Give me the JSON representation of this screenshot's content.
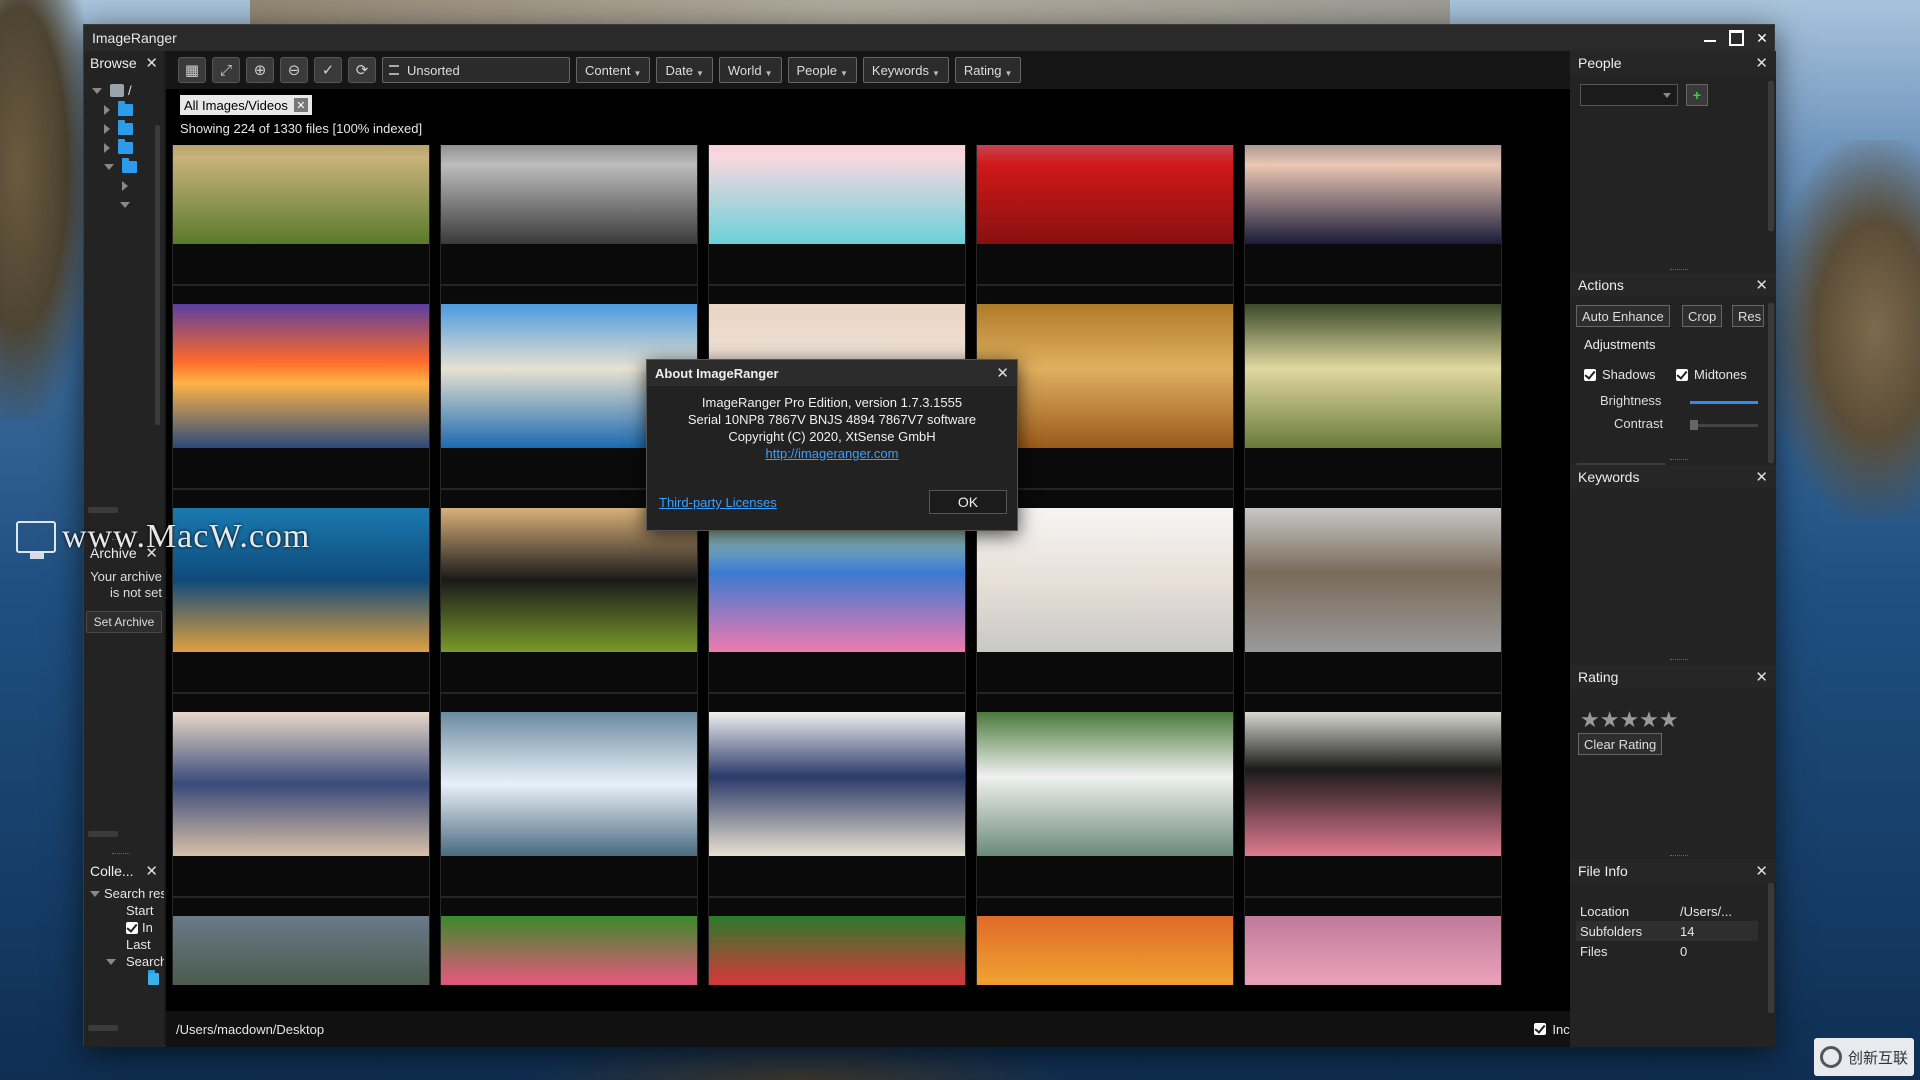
{
  "app": {
    "title": "ImageRanger",
    "close_glyph": "✕"
  },
  "watermarks": {
    "left_text": "www.MacW.com",
    "right_text": "创新互联"
  },
  "browse_panel": {
    "title": "Browse",
    "root_label": "/"
  },
  "archive_panel": {
    "title": "Archive",
    "message": "Your archive is not set",
    "set_button": "Set Archive"
  },
  "collections_panel": {
    "title": "Colle...",
    "items": [
      {
        "label": "Search results",
        "indent": 0,
        "expander": "down"
      },
      {
        "label": "Start",
        "indent": 1
      },
      {
        "label": "In",
        "indent": 1,
        "checked": true
      },
      {
        "label": "Last",
        "indent": 1
      },
      {
        "label": "Search",
        "indent": 1,
        "expander": "down"
      }
    ]
  },
  "toolbar": {
    "icons": [
      "grid-view-icon",
      "fit-icon",
      "zoom-in-icon",
      "zoom-out-icon",
      "check-icon",
      "refresh-icon"
    ],
    "icon_glyphs": [
      "▦",
      "⤢",
      "⊕",
      "⊖",
      "✓",
      "⟳"
    ],
    "sort_label": "Unsorted",
    "filters": [
      "Content",
      "Date",
      "World",
      "People",
      "Keywords",
      "Rating"
    ]
  },
  "filter_tag": {
    "label": "All Images/Videos",
    "remove_glyph": "✕"
  },
  "status": "Showing 224 of 1330 files [100% indexed]",
  "thumbnails": [
    {
      "name": "girl-flowers",
      "grad": "linear-gradient(180deg,#7a6a3a,#c9b27b 40%,#5a7a2a)"
    },
    {
      "name": "white-dress-dark",
      "grad": "linear-gradient(180deg,#2a2a2a,#bdbdbd 45%,#3a3a3a)"
    },
    {
      "name": "cupcake",
      "grad": "linear-gradient(180deg,#f4a9c4,#f7d8df 40%,#6bd0d9)"
    },
    {
      "name": "red-dress",
      "grad": "linear-gradient(180deg,#b8a6c8,#d01818 45%,#8a1010)"
    },
    {
      "name": "woman-lying",
      "grad": "linear-gradient(180deg,#2b2b4a,#e9c7b3 45%,#1b1b3a)"
    },
    {
      "name": "sunset-silhouette",
      "grad": "linear-gradient(180deg,#5a3fa0,#ff6a2a 40%,#ffb347 55%,#2a4a7a)"
    },
    {
      "name": "coastal-town",
      "grad": "linear-gradient(180deg,#4a9be0,#e8e1d0 45%,#1b6ab0)"
    },
    {
      "name": "woman-bag",
      "grad": "linear-gradient(180deg,#e9d3c5,#f1e4da 45%,#c9a090)"
    },
    {
      "name": "woman-lingerie",
      "grad": "linear-gradient(180deg,#b07c2a,#e0b060 45%,#9a5a1a)"
    },
    {
      "name": "violinist",
      "grad": "linear-gradient(180deg,#3a4a2a,#e0d8a0 45%,#6a7a3a)"
    },
    {
      "name": "tropical-fish",
      "grad": "linear-gradient(180deg,#1a7ab0,#0f4a7a 50%,#e0a040)"
    },
    {
      "name": "woman-black-top",
      "grad": "linear-gradient(180deg,#d9b07a,#1a1a1a 50%,#7a9a2a)"
    },
    {
      "name": "bluebird-blossom",
      "grad": "linear-gradient(180deg,#c9e8a0,#3a7ad0 45%,#f07ab0)"
    },
    {
      "name": "brides-group",
      "grad": "linear-gradient(180deg,#f5f5f5,#e8e0d8 50%,#c8c8c8)"
    },
    {
      "name": "kitten",
      "grad": "linear-gradient(180deg,#c8c8c8,#7a6a5a 45%,#9a9a9a)"
    },
    {
      "name": "sleeping-child",
      "grad": "linear-gradient(180deg,#e8d8c8,#3a4a7a 50%,#d8c0a8)"
    },
    {
      "name": "bride-running",
      "grad": "linear-gradient(180deg,#6a8aa0,#e8f0f8 50%,#4a6a80)"
    },
    {
      "name": "woman-sweater",
      "grad": "linear-gradient(180deg,#f0f0f0,#2a3a6a 45%,#e8e0d0)"
    },
    {
      "name": "crane-bird",
      "grad": "linear-gradient(180deg,#4a7a3a,#f0f0f0 45%,#6a8a7a)"
    },
    {
      "name": "woman-bench",
      "grad": "linear-gradient(180deg,#d8d8d0,#1a1a1a 40%,#e07a90)"
    },
    {
      "name": "girl-umbrella",
      "grad": "linear-gradient(180deg,#6a7a8a,#4a5a4a 50%,#c08a70)"
    },
    {
      "name": "parrots",
      "grad": "linear-gradient(180deg,#3a8a2a,#e05a7a 45%,#2a5a1a)"
    },
    {
      "name": "train-tracks",
      "grad": "linear-gradient(180deg,#2a7a2a,#d03a3a 45%,#4a4a3a)"
    },
    {
      "name": "autumn-leaves",
      "grad": "linear-gradient(180deg,#e06a2a,#f0a030 45%,#c02a2a)"
    },
    {
      "name": "woman-lavender",
      "grad": "linear-gradient(180deg,#c07a9a,#e8a0b8 45%,#8a6a9a)"
    }
  ],
  "path_bar": {
    "path": "/Users/macdown/Desktop",
    "include_label": "Include Subfold"
  },
  "about_dialog": {
    "title": "About ImageRanger",
    "line1": "ImageRanger Pro Edition, version 1.7.3.1555",
    "line2": "Serial 10NP8 7867V BNJS 4894 7867V7 software",
    "line3": "Copyright (C) 2020, XtSense GmbH",
    "url": "http://imageranger.com",
    "licenses_link": "Third-party Licenses",
    "ok": "OK"
  },
  "people_panel": {
    "title": "People",
    "add_glyph": "+"
  },
  "actions_panel": {
    "title": "Actions",
    "buttons": [
      "Auto Enhance",
      "Crop",
      "Res"
    ],
    "adjustments_label": "Adjustments",
    "shadows": "Shadows",
    "midtones": "Midtones",
    "brightness": "Brightness",
    "contrast": "Contrast",
    "brightness_level": 1.0,
    "contrast_level": 0.0
  },
  "keywords_panel": {
    "title": "Keywords"
  },
  "rating_panel": {
    "title": "Rating",
    "stars": "★★★★★",
    "clear": "Clear Rating"
  },
  "file_info_panel": {
    "title": "File Info",
    "rows": [
      {
        "key": "Location",
        "value": "/Users/..."
      },
      {
        "key": "Subfolders",
        "value": "14"
      },
      {
        "key": "Files",
        "value": "0"
      }
    ]
  }
}
